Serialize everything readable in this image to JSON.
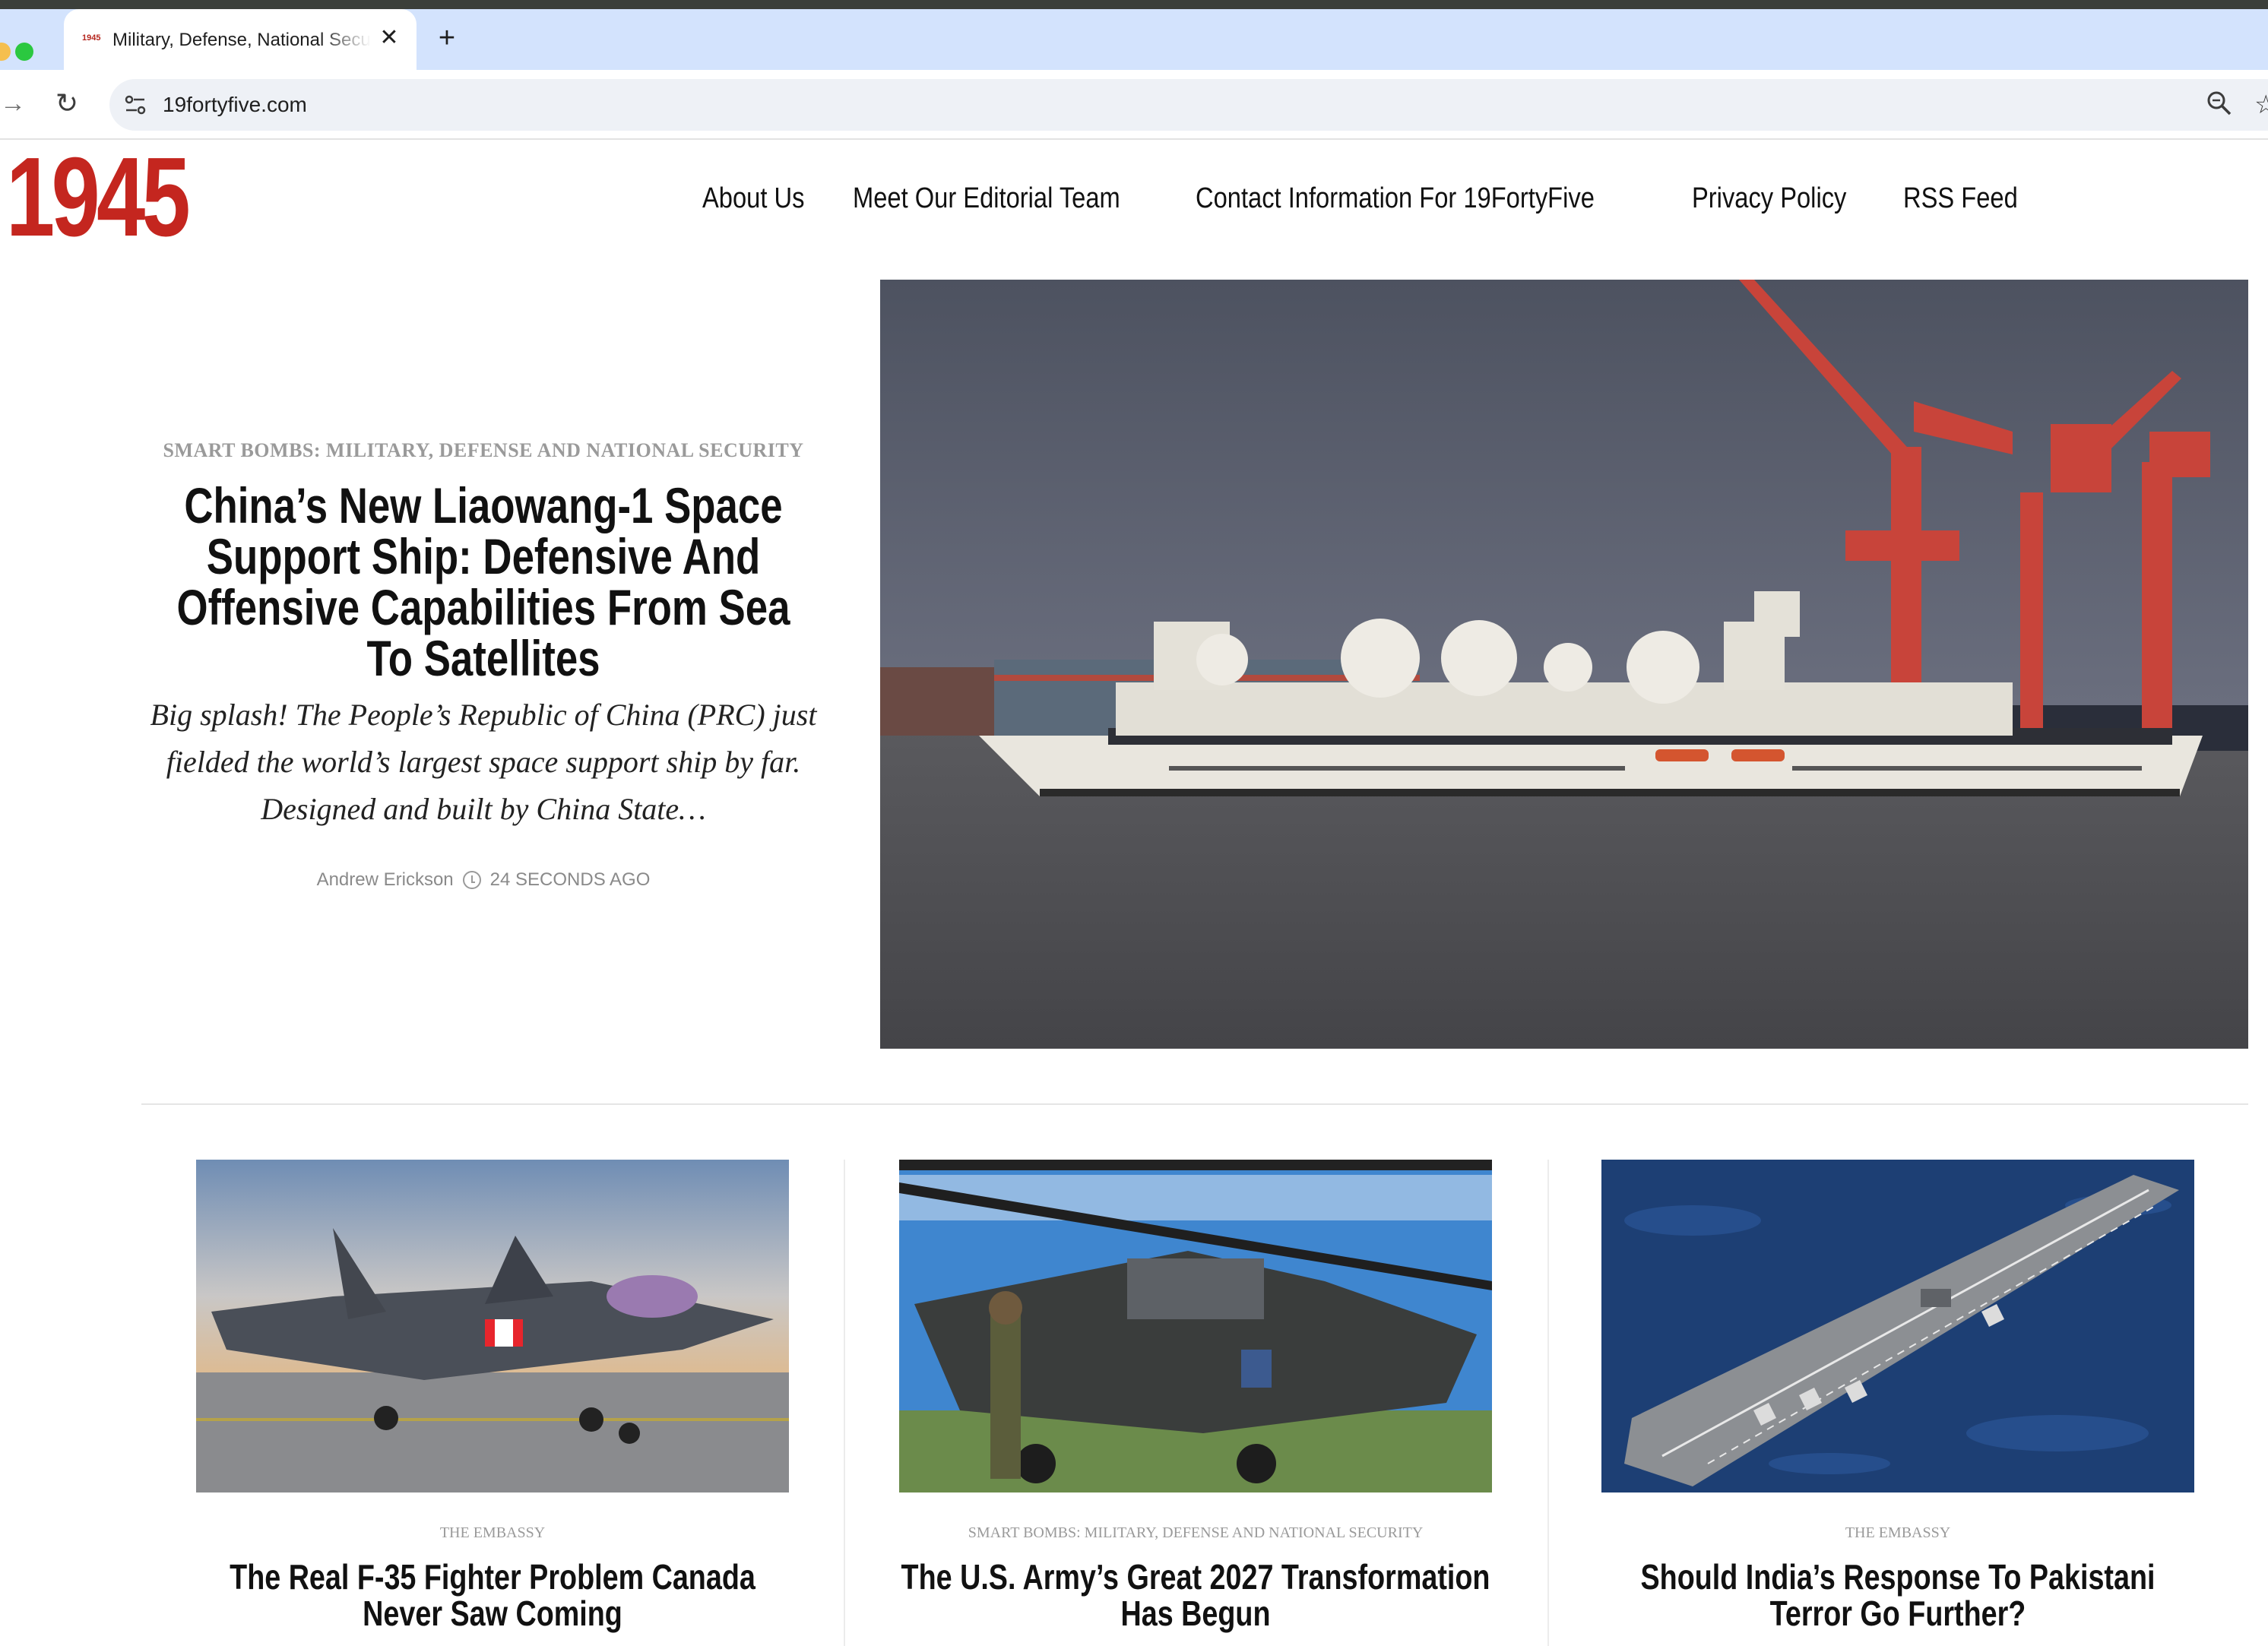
{
  "browser": {
    "tab_title": "Military, Defense, National Security",
    "tab_favicon_text": "1945",
    "url": "19fortyfive.com"
  },
  "site": {
    "logo": "1945",
    "nav": [
      "About Us",
      "Meet Our Editorial Team",
      "Contact Information For 19FortyFive",
      "Privacy Policy",
      "RSS Feed"
    ]
  },
  "hero": {
    "kicker": "SMART BOMBS: MILITARY, DEFENSE AND NATIONAL SECURITY",
    "title": "China’s New Liaowang-1 Space Support Ship: Defensive And Offensive Capabilities From Sea To Satellites",
    "excerpt": "Big splash! The People’s Republic of China (PRC) just fielded the world’s largest space support ship by far. Designed and built by China State…",
    "author": "Andrew Erickson",
    "time": "24 SECONDS AGO"
  },
  "cards": [
    {
      "kicker": "THE EMBASSY",
      "title": "The Real F-35 Fighter Problem Canada Never Saw Coming"
    },
    {
      "kicker": "SMART BOMBS: MILITARY, DEFENSE AND NATIONAL SECURITY",
      "title": "The U.S. Army’s Great 2027 Transformation Has Begun"
    },
    {
      "kicker": "THE EMBASSY",
      "title": "Should India’s Response To Pakistani Terror Go Further?"
    }
  ],
  "colors": {
    "brand_red": "#c4261f",
    "tab_bar": "#d3e3fd"
  }
}
